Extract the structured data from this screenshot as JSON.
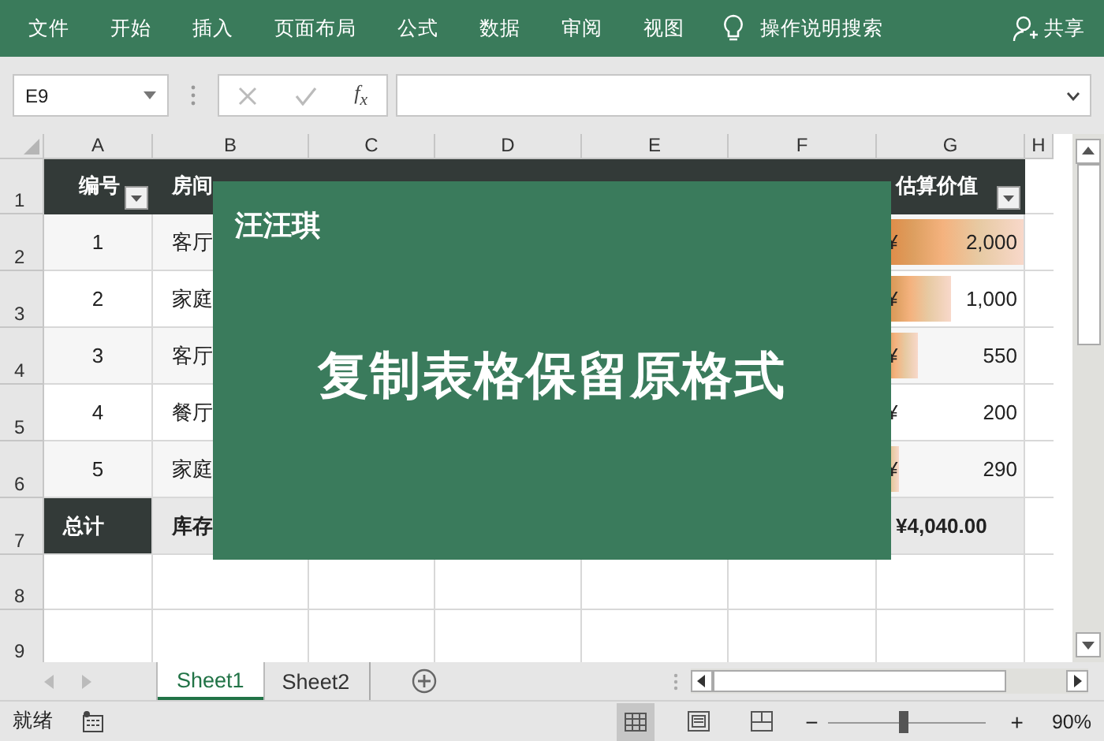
{
  "menu": {
    "items": [
      "文件",
      "开始",
      "插入",
      "页面布局",
      "公式",
      "数据",
      "审阅",
      "视图"
    ],
    "search": "操作说明搜索",
    "share": "共享"
  },
  "formula_bar": {
    "name_box": "E9",
    "function_label": "f$_{x}$"
  },
  "columns": [
    "A",
    "B",
    "C",
    "D",
    "E",
    "F",
    "G",
    "H"
  ],
  "header_row": {
    "number": "1",
    "id_label": "编号",
    "room_label": "房间",
    "value_label": "估算价值"
  },
  "data_rows": [
    {
      "number": "2",
      "id": "1",
      "room": "客厅",
      "currency": "¥",
      "amount": "2,000",
      "level": 1
    },
    {
      "number": "3",
      "id": "2",
      "room": "家庭",
      "currency": "¥",
      "amount": "1,000",
      "level": 0.5
    },
    {
      "number": "4",
      "id": "3",
      "room": "客厅",
      "currency": "¥",
      "amount": "550",
      "level": 0.28
    },
    {
      "number": "5",
      "id": "4",
      "room": "餐厅",
      "currency": "¥",
      "amount": "200",
      "level": 0.1
    },
    {
      "number": "6",
      "id": "5",
      "room": "家庭",
      "currency": "¥",
      "amount": "290",
      "level": 0.15
    }
  ],
  "total_row": {
    "number": "7",
    "label": "总计",
    "room": "库存",
    "total": "¥4,040.00"
  },
  "empty_rows": [
    "8",
    "9"
  ],
  "overlay": {
    "author": "汪汪琪",
    "title": "复制表格保留原格式"
  },
  "sheet_tabs": [
    {
      "label": "Sheet1",
      "selected": true
    },
    {
      "label": "Sheet2",
      "selected": false
    }
  ],
  "status_bar": {
    "status": "就绪",
    "zoom_out": "−",
    "zoom_in": "+",
    "zoom": "90%",
    "zoom_slider": {
      "level": 0.48
    }
  }
}
